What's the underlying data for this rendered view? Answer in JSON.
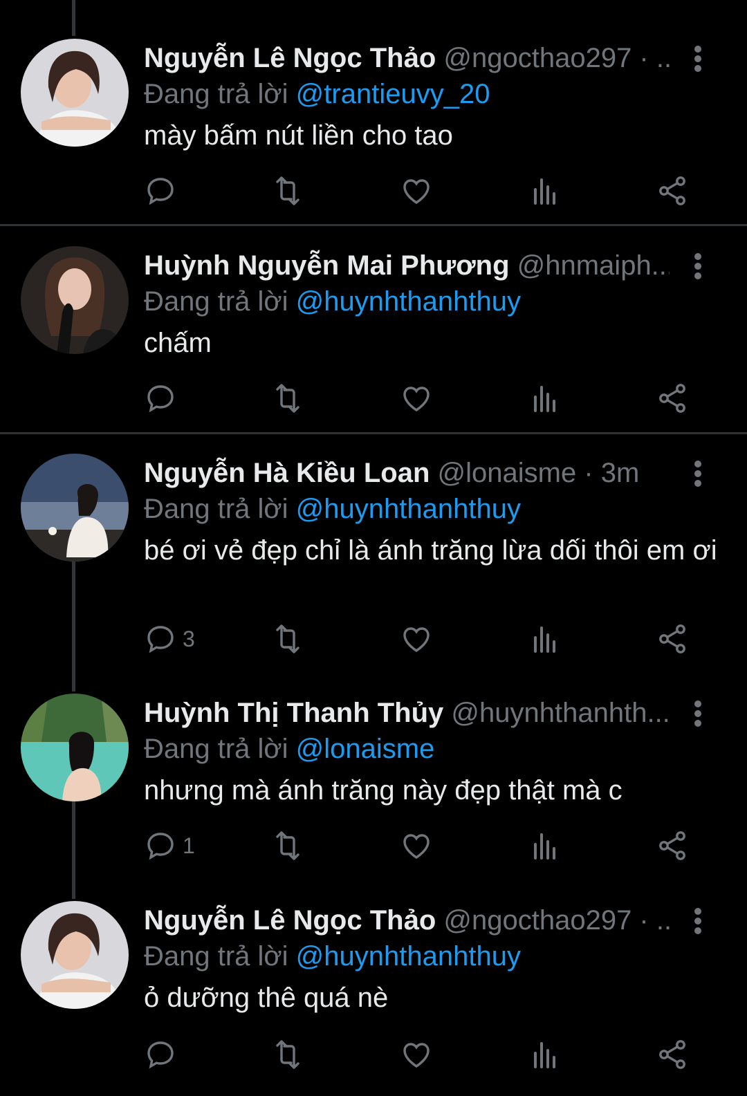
{
  "theme": {
    "background": "#000000",
    "text": "#e7e9ea",
    "muted": "#71767b",
    "accent": "#1d9bf0",
    "divider": "#2f3336"
  },
  "reply_prefix": "Đang trả lời",
  "tweets": [
    {
      "name": "Nguyễn Lê Ngọc Thảo",
      "handle": "@ngocthao297 · ...",
      "reply_to": "@trantieuvy_20",
      "text": "mày bấm nút liền cho tao",
      "reply_count": "",
      "avatar": "woman-portrait-white-dress"
    },
    {
      "name": "Huỳnh Nguyễn Mai Phương",
      "handle": "@hnmaiph...",
      "reply_to": "@huynhthanhthuy",
      "text": "chấm",
      "reply_count": "",
      "avatar": "woman-portrait-black-gloves"
    },
    {
      "name": "Nguyễn Hà Kiều Loan",
      "handle": "@lonaisme · 3m",
      "reply_to": "@huynhthanhthuy",
      "text": "bé ơi vẻ đẹp chỉ là ánh trăng lừa dối thôi em ơi",
      "reply_count": "3",
      "avatar": "woman-dusk-sea"
    },
    {
      "name": "Huỳnh Thị Thanh Thủy",
      "handle": "@huynhthanhth...",
      "reply_to": "@lonaisme",
      "text": "nhưng mà ánh trăng này đẹp thật mà c",
      "reply_count": "1",
      "avatar": "woman-pool"
    },
    {
      "name": "Nguyễn Lê Ngọc Thảo",
      "handle": "@ngocthao297 · ...",
      "reply_to": "@huynhthanhthuy",
      "text": "ỏ dưỡng thê quá nè",
      "reply_count": "",
      "avatar": "woman-portrait-white-dress"
    }
  ],
  "icons": [
    "reply-icon",
    "retweet-icon",
    "like-icon",
    "views-icon",
    "share-icon",
    "more-icon"
  ]
}
